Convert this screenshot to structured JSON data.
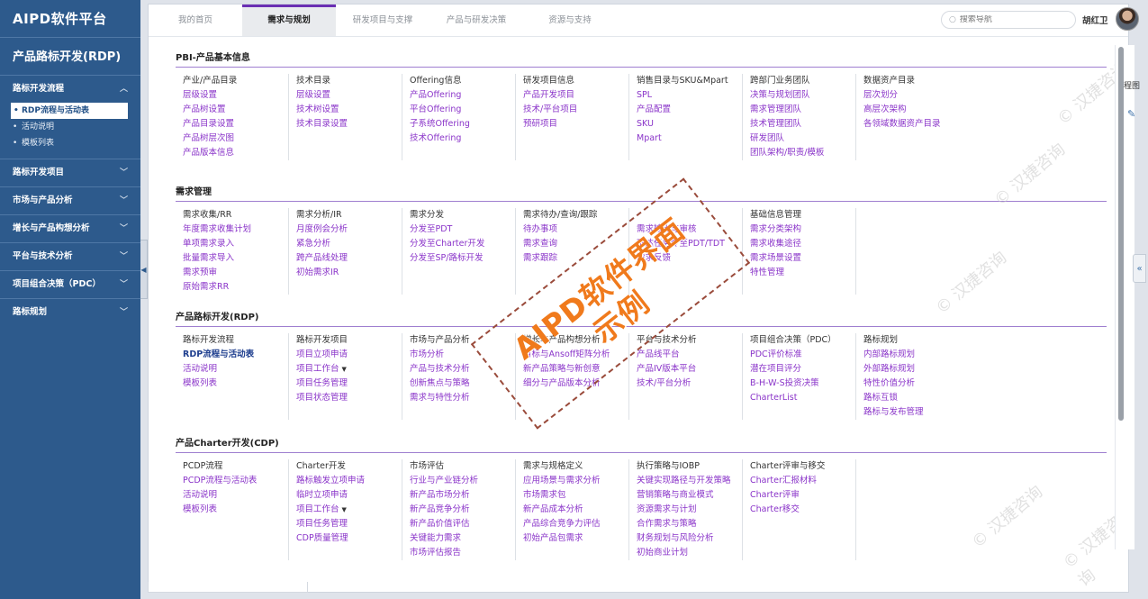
{
  "sidebar": {
    "app_title": "AIPD软件平台",
    "module_title": "产品路标开发(RDP)",
    "groups": [
      {
        "label": "路标开发流程",
        "chevron": "^",
        "items": [
          {
            "label": "RDP流程与活动表",
            "active": true
          },
          {
            "label": "活动说明"
          },
          {
            "label": "模板列表"
          }
        ]
      },
      {
        "label": "路标开发项目",
        "chevron": "v"
      },
      {
        "label": "市场与产品分析",
        "chevron": "v"
      },
      {
        "label": "增长与产品构想分析",
        "chevron": "v"
      },
      {
        "label": "平台与技术分析",
        "chevron": "v"
      },
      {
        "label": "项目组合决策（PDC）",
        "chevron": "v"
      },
      {
        "label": "路标规划",
        "chevron": "v"
      }
    ]
  },
  "topbar": {
    "tabs": [
      "我的首页",
      "需求与规划",
      "研发项目与支撑",
      "产品与研发决策",
      "资源与支持"
    ],
    "active_tab": 1,
    "search_placeholder": "搜索导航",
    "user_name": "胡红卫"
  },
  "sections": [
    {
      "title": "PBI-产品基本信息",
      "columns": [
        {
          "head": "产业/产品目录",
          "links": [
            "层级设置",
            "产品树设置",
            "产品目录设置",
            "产品树层次图",
            "产品版本信息"
          ]
        },
        {
          "head": "技术目录",
          "links": [
            "层级设置",
            "技术树设置",
            "技术目录设置"
          ]
        },
        {
          "head": "Offering信息",
          "links": [
            "产品Offering",
            "平台Offering",
            "子系统Offering",
            "技术Offering"
          ]
        },
        {
          "head": "研发项目信息",
          "links": [
            "产品开发项目",
            "技术/平台项目",
            "预研项目"
          ]
        },
        {
          "head": "销售目录与SKU&Mpart",
          "links": [
            "SPL",
            "产品配置",
            "SKU",
            "Mpart"
          ]
        },
        {
          "head": "跨部门业务团队",
          "links": [
            "决策与规划团队",
            "需求管理团队",
            "技术管理团队",
            "研发团队",
            "团队架构/职责/模板"
          ]
        },
        {
          "head": "数据资产目录",
          "links": [
            "层次划分",
            "高层次架构",
            "各领域数据资产目录"
          ]
        }
      ]
    },
    {
      "title": "需求管理",
      "columns": [
        {
          "head": "需求收集/RR",
          "links": [
            "年度需求收集计划",
            "单项需求录入",
            "批量需求导入",
            "需求预审",
            "原始需求RR"
          ]
        },
        {
          "head": "需求分析/IR",
          "links": [
            "月度例会分析",
            "紧急分析",
            "跨产品线处理",
            "初始需求IR"
          ]
        },
        {
          "head": "需求分发",
          "links": [
            "分发至PDT",
            "分发至Charter开发",
            "分发至SP/路标开发"
          ]
        },
        {
          "head": "需求待办/查询/跟踪",
          "links": [
            "待办事项",
            "需求查询",
            "需求跟踪"
          ]
        },
        {
          "head": "需求输出与审核",
          "links": [
            "需求输出与审核",
            "下达任务令至PDT/TDT",
            "需求反馈"
          ],
          "hide_head": true
        },
        {
          "head": "基础信息管理",
          "links": [
            "需求分类架构",
            "需求收集途径",
            "需求场景设置",
            "特性管理"
          ]
        },
        {
          "head": "",
          "links": []
        }
      ]
    },
    {
      "title": "产品路标开发(RDP)",
      "columns": [
        {
          "head": "路标开发流程",
          "links": [
            "RDP流程与活动表",
            "活动说明",
            "模板列表"
          ],
          "dark_first": true
        },
        {
          "head": "路标开发项目",
          "links": [
            "项目立项申请",
            "项目工作台",
            "项目任务管理",
            "项目状态管理"
          ],
          "caret_index": 1
        },
        {
          "head": "市场与产品分析",
          "links": [
            "市场分析",
            "产品与技术分析",
            "创新焦点与策略",
            "需求与特性分析"
          ]
        },
        {
          "head": "增长与产品构想分析",
          "links": [
            "目标与Ansoff矩阵分析",
            "新产品策略与新创意",
            "细分与产品版本分析"
          ]
        },
        {
          "head": "平台与技术分析",
          "links": [
            "产品线平台",
            "产品IV版本平台",
            "技术/平台分析"
          ]
        },
        {
          "head": "项目组合决策（PDC）",
          "links": [
            "PDC评价标准",
            "潜在项目评分",
            "B-H-W-S投资决策",
            "CharterList"
          ]
        },
        {
          "head": "路标规划",
          "links": [
            "内部路标规划",
            "外部路标规划",
            "特性价值分析",
            "路标互锁",
            "路标与发布管理"
          ]
        }
      ]
    },
    {
      "title": "产品Charter开发(CDP)",
      "columns": [
        {
          "head": "PCDP流程",
          "links": [
            "PCDP流程与活动表",
            "活动说明",
            "模板列表"
          ]
        },
        {
          "head": "Charter开发",
          "links": [
            "路标触发立项申请",
            "临时立项申请",
            "项目工作台",
            "项目任务管理",
            "CDP质量管理"
          ],
          "caret_index": 2
        },
        {
          "head": "市场评估",
          "links": [
            "行业与产业链分析",
            "新产品市场分析",
            "新产品竞争分析",
            "新产品价值评估",
            "关键能力需求",
            "市场评估报告"
          ]
        },
        {
          "head": "需求与规格定义",
          "links": [
            "应用场景与需求分析",
            "市场需求包",
            "新产品成本分析",
            "产品综合竞争力评估",
            "初始产品包需求"
          ]
        },
        {
          "head": "执行策略与IOBP",
          "links": [
            "关键实现路径与开发策略",
            "营销策略与商业模式",
            "资源需求与计划",
            "合作需求与策略",
            "财务规划与风险分析",
            "初始商业计划"
          ]
        },
        {
          "head": "Charter评审与移交",
          "links": [
            "Charter汇报材料",
            "Charter评审",
            "Charter移交"
          ]
        },
        {
          "head": "",
          "links": []
        }
      ]
    }
  ],
  "stamp": {
    "line1": "AIPD软件界面",
    "line2": "示例"
  },
  "watermark_text": "© 汉捷咨询",
  "right_panel": {
    "partial_text": "程图"
  },
  "colors": {
    "sidebar": "#2d5a8c",
    "accent": "#6a2fb3",
    "link": "#8a34c9",
    "stamp": "#f07a1c"
  }
}
